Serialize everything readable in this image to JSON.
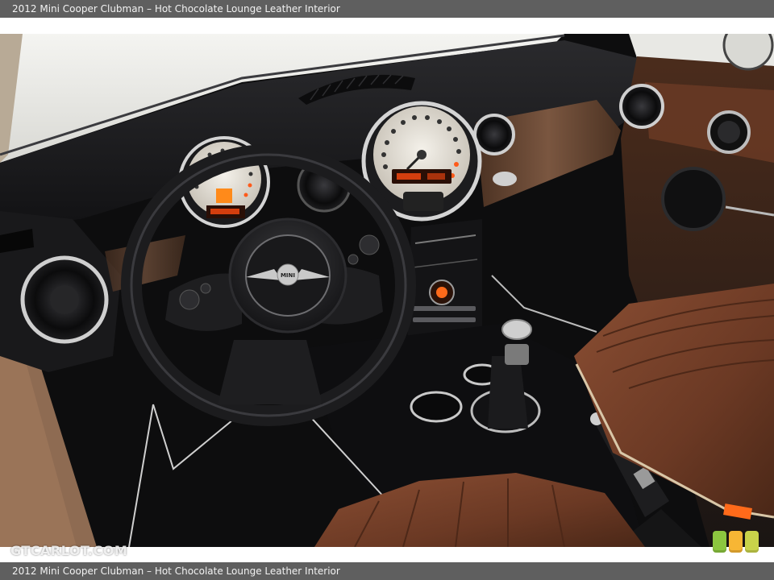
{
  "caption": {
    "top": "2012 Mini Cooper Clubman – Hot Chocolate Lounge Leather Interior",
    "bottom": "2012 Mini Cooper Clubman – Hot Chocolate Lounge Leather Interior"
  },
  "watermark": "GTCARLOT.COM",
  "photo": {
    "logo_text": "MINI",
    "colors": {
      "leather": "#6e3d27",
      "dash": "#1b1b1d",
      "wood": "#5a3b29",
      "chrome": "#c9c9c9",
      "gauge_face": "#e9e4dc",
      "accent_orange": "#ff6a1a"
    }
  },
  "rating_badges": [
    "#8cc63f",
    "#f7b634",
    "#c9d34a"
  ]
}
